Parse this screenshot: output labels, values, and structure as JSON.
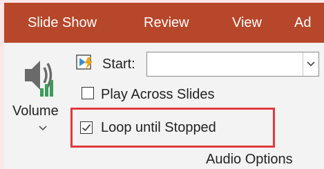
{
  "tabs": [
    {
      "label": "Slide Show"
    },
    {
      "label": "Review"
    },
    {
      "label": "View"
    },
    {
      "label": "Ad"
    }
  ],
  "volume": {
    "label": "Volume",
    "icon": "speaker-volume-icon"
  },
  "start": {
    "label": "Start:",
    "value": "",
    "icon": "start-trigger-icon"
  },
  "play_across_slides": {
    "label": "Play Across Slides",
    "checked": false
  },
  "loop_until_stopped": {
    "label": "Loop until Stopped",
    "checked": true
  },
  "group": {
    "label": "Audio Options"
  },
  "colors": {
    "ribbon_tab_bar": "#b7472a",
    "highlight": "#e0393e",
    "ribbon_bg": "#f3f3f3"
  }
}
